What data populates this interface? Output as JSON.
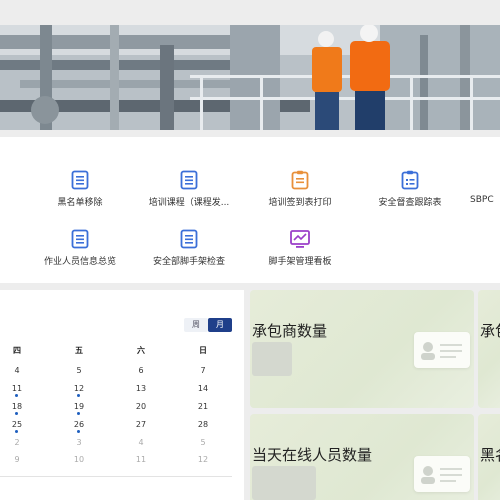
{
  "menu": {
    "row1": [
      {
        "label": "黑名单移除",
        "icon": "document-icon"
      },
      {
        "label": "培训课程（课程发...",
        "icon": "document-icon"
      },
      {
        "label": "培训签到表打印",
        "icon": "clipboard-icon"
      },
      {
        "label": "安全督查跟踪表",
        "icon": "checklist-icon"
      },
      {
        "label": "SBPC",
        "icon": "document-icon"
      }
    ],
    "row2": [
      {
        "label": "作业人员信息总览",
        "icon": "document-icon"
      },
      {
        "label": "安全部脚手架检查",
        "icon": "document-icon"
      },
      {
        "label": "脚手架管理看板",
        "icon": "chart-monitor-icon"
      }
    ]
  },
  "calendar": {
    "toggle_week": "周",
    "toggle_month": "月",
    "weekdays": [
      "四",
      "五",
      "六",
      "日"
    ],
    "rows": [
      [
        "4",
        "5",
        "6",
        "7"
      ],
      [
        "11",
        "12",
        "13",
        "14"
      ],
      [
        "18",
        "19",
        "20",
        "21"
      ],
      [
        "25",
        "26",
        "27",
        "28"
      ],
      [
        "2",
        "3",
        "4",
        "5"
      ],
      [
        "9",
        "10",
        "11",
        "12"
      ]
    ]
  },
  "cards": {
    "contractors_title": "承包商数量",
    "contractors_title_cut": "承包",
    "online_title": "当天在线人员数量",
    "blacklist_title_cut": "黑名"
  },
  "colors": {
    "icon_blue": "#3b6fd8",
    "icon_orange": "#e8903a",
    "icon_purple": "#9b3fc9",
    "accent": "#1f3f8a"
  }
}
